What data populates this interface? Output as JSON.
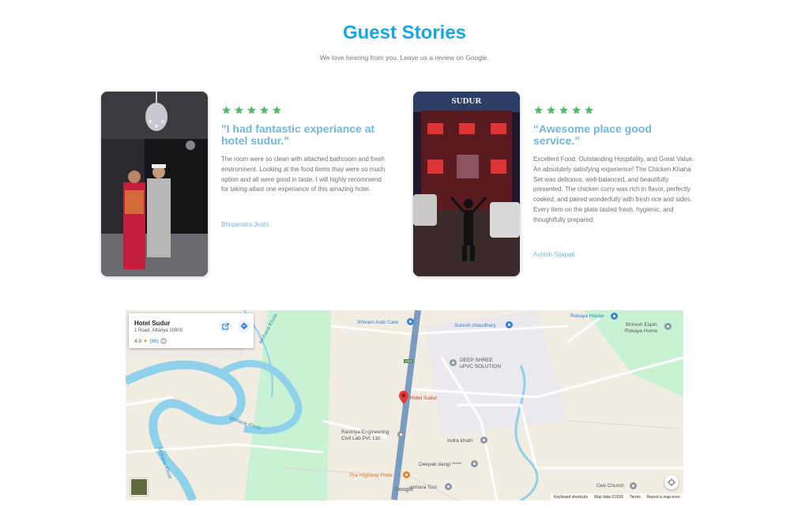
{
  "section": {
    "title": "Guest Stories",
    "subtitle": "We love hearing from you. Leave us a review on Google."
  },
  "reviews": [
    {
      "quote": "\"I had fantastic experiance at hotel sudur.\"",
      "body": "The room were so clean with attached bathroom and fresh environment. Looking at the food items thay were so much option and all were good in taste. I will highly recommend for taking atlast one experiance of this amazing hotel.",
      "author": "Bhupendra Joshi",
      "rating": 5
    },
    {
      "quote": "“Awesome place good service.”",
      "body": "Excellent Food, Outstanding Hospitality, and Great Value.\nAn absolutely satisfying experience! The Chicken Khana Set was delicious, well-balanced, and beautifully presented. The chicken curry was rich in flavor, perfectly cooked, and paired wonderfully with fresh rice and sides. Every item on the plate tasted fresh, hygienic, and thoughtfully prepared.",
      "author": "Ashish Sijapati",
      "rating": 5,
      "photo_sign": "SUDUR"
    }
  ],
  "map": {
    "place_name": "Hotel Sudur",
    "address": "1 Road, Attariya 10900",
    "rating": "4.9",
    "review_count": "(96)",
    "labels": {
      "shivam": "Shivam Auto Care",
      "suresh": "Suresh chaudhary",
      "rokaya": "Rokaya House",
      "shiresh": "Shiresh Espin\nRokaya Home",
      "deep": "DEEP SHREE\nuPVC SOLUTION",
      "hotel": "Hotel Sudur",
      "rastriya": "Rastriya Engineering\nCivil Lab Pvt. Ltd.",
      "indra": "Indra khatri",
      "deepak": "Deepak dangi *****",
      "highway": "The Highway Plate",
      "manhara": "anhara Tool",
      "geti": "Geti Church",
      "river1": "Mohana Khola",
      "river2": "Mohana Khola",
      "river3": "Mohana Khola",
      "road": "H13"
    },
    "footer": {
      "shortcuts": "Keyboard shortcuts",
      "mapdata": "Map data ©2026",
      "terms": "Terms",
      "report": "Report a map error"
    },
    "google": "Google"
  }
}
